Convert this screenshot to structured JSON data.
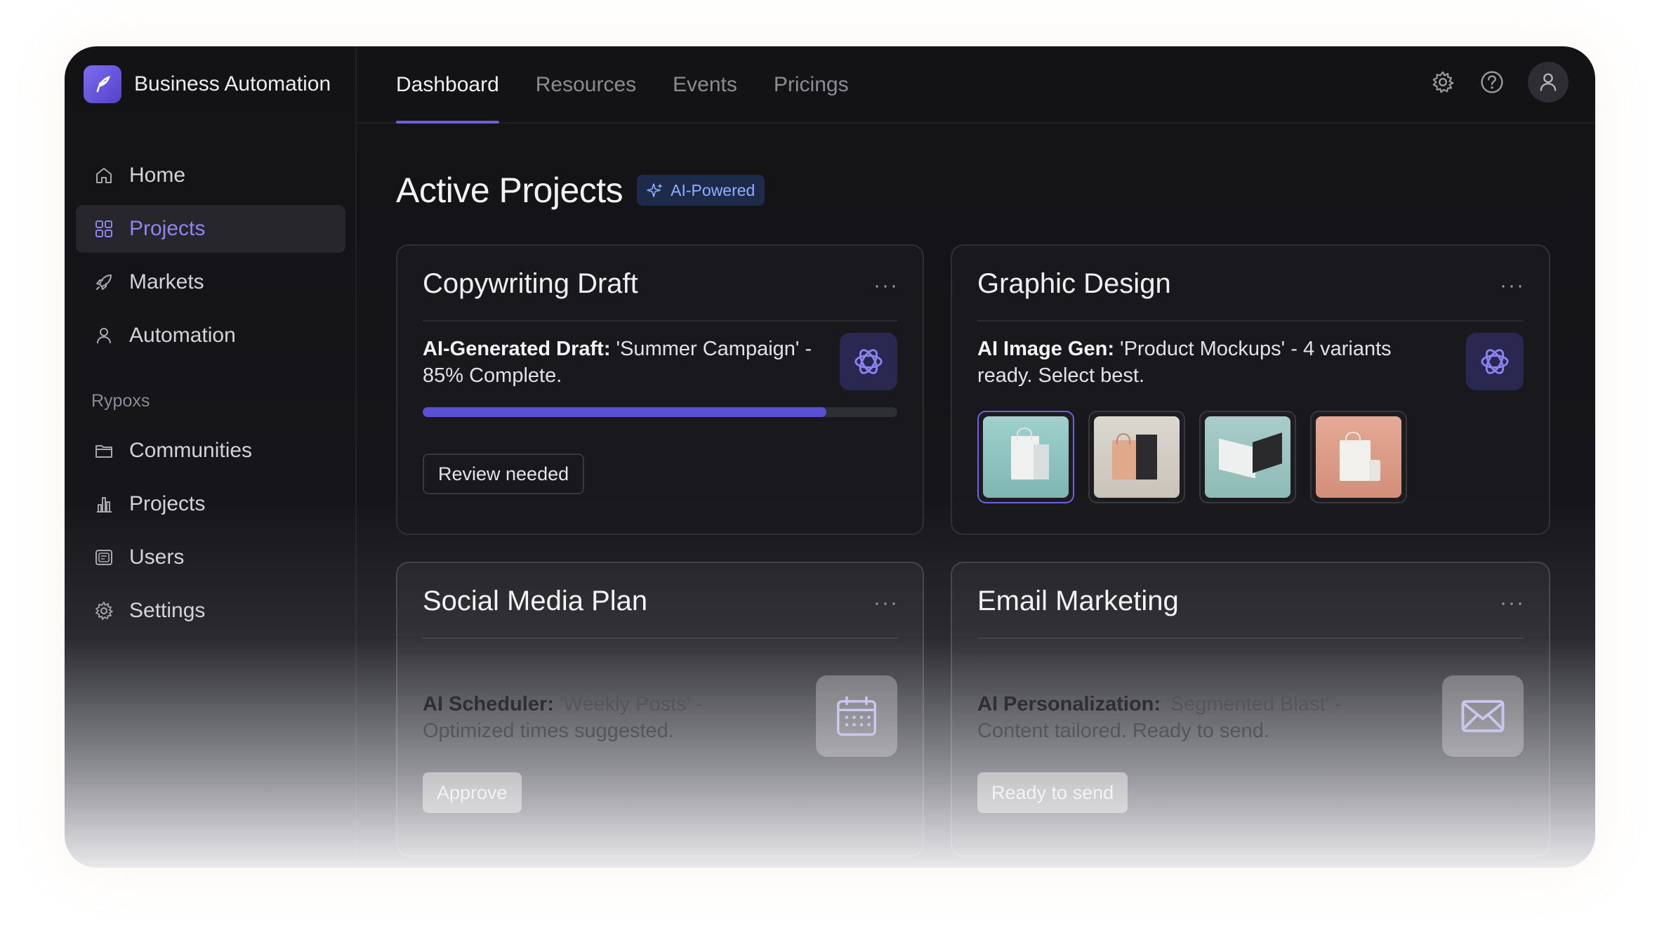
{
  "app": {
    "name": "Business Automation",
    "logo_icon": "feather-logo-icon"
  },
  "sidebar": {
    "items": [
      {
        "label": "Home",
        "icon": "home-icon",
        "active": false
      },
      {
        "label": "Projects",
        "icon": "grid-icon",
        "active": true
      },
      {
        "label": "Markets",
        "icon": "rocket-icon",
        "active": false
      },
      {
        "label": "Automation",
        "icon": "user-icon",
        "active": false
      }
    ],
    "section_label": "Rypoxs",
    "section_items": [
      {
        "label": "Communities",
        "icon": "folder-icon"
      },
      {
        "label": "Projects",
        "icon": "bar-chart-icon"
      },
      {
        "label": "Users",
        "icon": "id-card-icon"
      },
      {
        "label": "Settings",
        "icon": "gear-icon"
      }
    ]
  },
  "topbar": {
    "tabs": [
      {
        "label": "Dashboard",
        "active": true
      },
      {
        "label": "Resources",
        "active": false
      },
      {
        "label": "Events",
        "active": false
      },
      {
        "label": "Pricings",
        "active": false
      }
    ],
    "icons": [
      "gear-icon",
      "help-icon",
      "user-avatar-icon"
    ]
  },
  "main": {
    "title": "Active Projects",
    "badge": "AI-Powered",
    "cards": {
      "copywriting": {
        "title": "Copywriting Draft",
        "menu": "···",
        "desc_bold": "AI-Generated Draft:",
        "desc_line1": " 'Summer Campaign' -",
        "desc_line2": "85% Complete.",
        "progress": 0.85,
        "chip": "Review needed"
      },
      "graphic": {
        "title": "Graphic Design",
        "menu": "···",
        "desc_bold": "AI Image Gen:",
        "desc_line1": " 'Product Mockups' - 4 variants",
        "desc_line2": "ready. Select best.",
        "selected_thumb": 0
      },
      "social": {
        "title": "Social Media Plan",
        "menu": "···",
        "desc_bold": "AI Scheduler:",
        "desc_line1": " 'Weekly Posts' -",
        "desc_line2": "Optimized times suggested.",
        "chip": "Approve"
      },
      "email": {
        "title": "Email Marketing",
        "menu": "···",
        "desc_bold": "AI Personalization:",
        "desc_line1": " 'Segmented Blast' -",
        "desc_line2": "Content tailored. Ready to send.",
        "chip": "Ready to send"
      }
    }
  },
  "colors": {
    "accent": "#6a5fe0",
    "active_nav_text": "#8d85f0",
    "badge_text": "#8fb0ff"
  }
}
